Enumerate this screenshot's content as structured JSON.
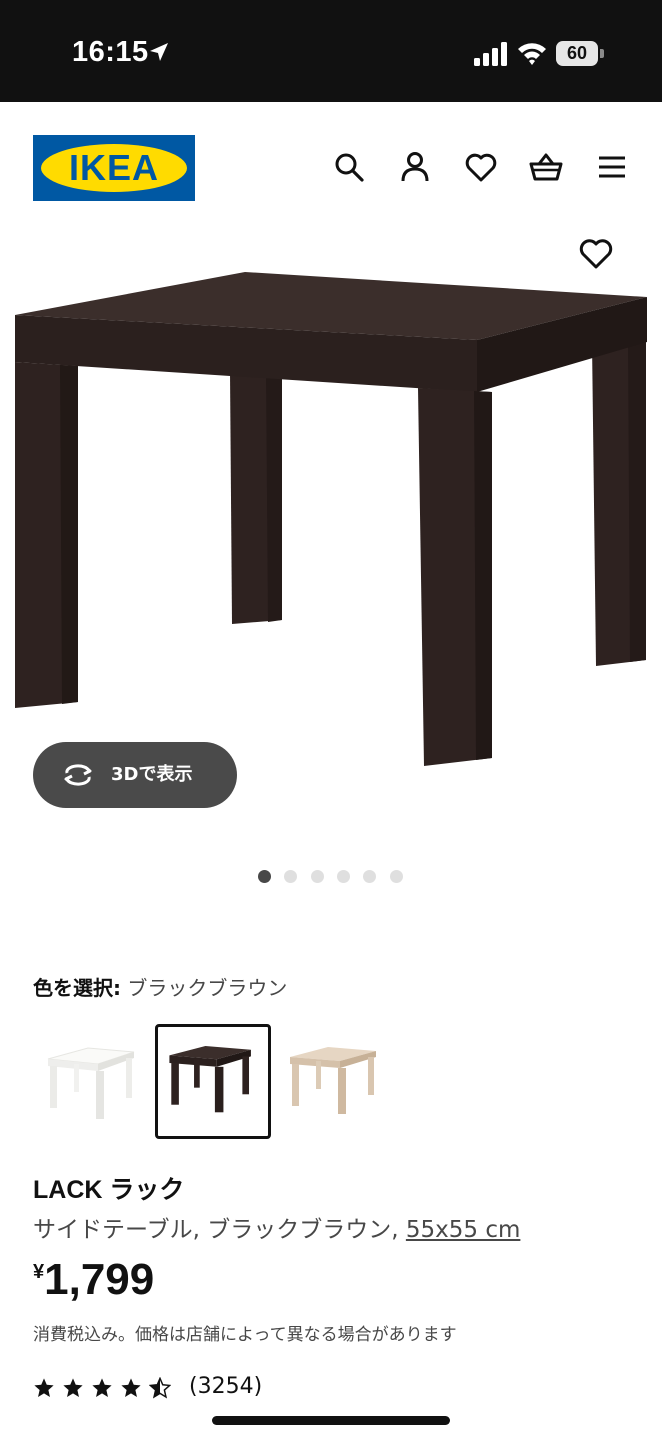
{
  "status_bar": {
    "time": "16:15",
    "battery_level": "60",
    "icons": [
      "location-arrow-icon",
      "cellular-signal-icon",
      "wifi-icon",
      "battery-icon"
    ]
  },
  "header": {
    "logo_text": "IKEA",
    "icons": [
      "search-icon",
      "account-icon",
      "wishlist-heart-icon",
      "shopping-basket-icon",
      "menu-hamburger-icon"
    ],
    "colors": {
      "logo_blue": "#0058a3",
      "logo_yellow": "#ffdb00"
    }
  },
  "gallery": {
    "view_3d_label": "3Dで表示",
    "image_count": 6,
    "active_index": 0
  },
  "color_selector": {
    "label": "色を選択:",
    "selected_value": "ブラックブラウン",
    "options": [
      {
        "name": "white",
        "color": "#f4f4f2",
        "selected": false
      },
      {
        "name": "black-brown",
        "color": "#2e2220",
        "selected": true
      },
      {
        "name": "white-stained-oak",
        "color": "#d9c6b0",
        "selected": false
      }
    ]
  },
  "product": {
    "name": "LACK ラック",
    "description": "サイドテーブル, ブラックブラウン,",
    "size": "55x55 cm",
    "currency": "¥",
    "price": "1,799",
    "tax_note": "消費税込み。価格は店舗によって異なる場合があります",
    "rating_stars": 4.5,
    "rating_max": 5,
    "review_count": "(3254)"
  }
}
